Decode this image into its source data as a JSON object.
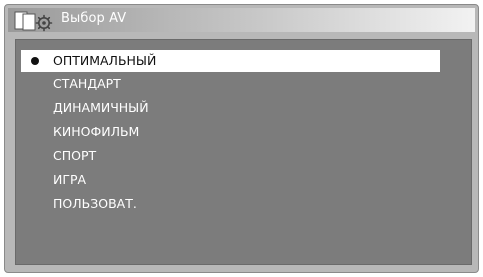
{
  "window": {
    "title": "Выбор AV",
    "icon": "av-settings-icon"
  },
  "menu": {
    "selected_index": 0,
    "items": [
      {
        "label": "ОПТИМАЛЬНЫЙ",
        "selected": true
      },
      {
        "label": "СТАНДАРТ",
        "selected": false
      },
      {
        "label": "ДИНАМИЧНЫЙ",
        "selected": false
      },
      {
        "label": "КИНОФИЛЬМ",
        "selected": false
      },
      {
        "label": "СПОРТ",
        "selected": false
      },
      {
        "label": "ИГРА",
        "selected": false
      },
      {
        "label": "ПОЛЬЗОВАТ.",
        "selected": false
      }
    ]
  },
  "colors": {
    "panel_background": "#7c7c7c",
    "frame_background": "#b8b8b8",
    "highlight": "#ffffff",
    "text": "#ffffff"
  }
}
